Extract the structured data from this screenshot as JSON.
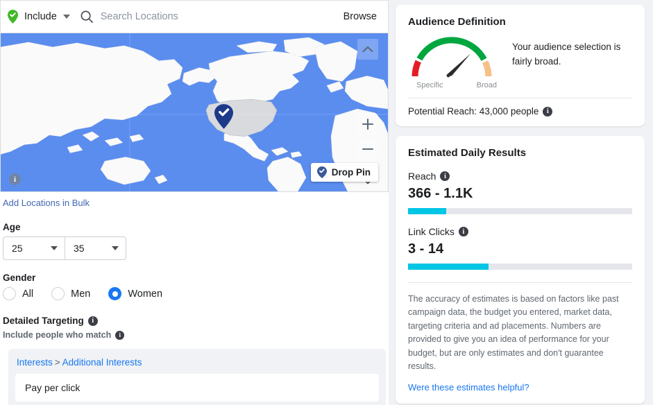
{
  "locations": {
    "include_label": "Include",
    "include_pin_icon": "map-pin-check-green-icon",
    "dropdown_caret_icon": "chevron-down-icon",
    "search_icon": "search-icon",
    "search_placeholder": "Search Locations",
    "search_value": "",
    "browse_label": "Browse",
    "bulk_link": "Add Locations in Bulk"
  },
  "map": {
    "collapse_icon": "chevron-up-icon",
    "zoom_in_icon": "plus-icon",
    "zoom_out_icon": "minus-icon",
    "locate_icon": "map-pin-locate-icon",
    "drop_pin_label": "Drop Pin",
    "drop_pin_icon": "map-pin-check-blue-icon",
    "info_icon": "info-icon",
    "marker_icon": "map-pin-check-navy-icon",
    "ocean_color": "#5b8def",
    "land_color": "#fafafa",
    "selected_region_color": "#d8dade"
  },
  "age": {
    "title": "Age",
    "min": "25",
    "max": "35"
  },
  "gender": {
    "title": "Gender",
    "options": [
      {
        "label": "All",
        "selected": false
      },
      {
        "label": "Men",
        "selected": false
      },
      {
        "label": "Women",
        "selected": true
      }
    ],
    "selected_color": "#1877f2"
  },
  "detailed_targeting": {
    "title": "Detailed Targeting",
    "title_info_icon": "info-icon",
    "subtitle": "Include people who match",
    "subtitle_info_icon": "info-icon",
    "breadcrumb_root": "Interests",
    "breadcrumb_sep": ">",
    "breadcrumb_leaf": "Additional Interests",
    "interest_value": "Pay per click"
  },
  "audience_definition": {
    "title": "Audience Definition",
    "gauge_low_label": "Specific",
    "gauge_high_label": "Broad",
    "gauge_needle_percent": 62,
    "gauge_colors": {
      "low": "#e41e26",
      "mid": "#00a63f",
      "high": "#f5c187"
    },
    "message": "Your audience selection is fairly broad.",
    "reach_label": "Potential Reach: 43,000 people",
    "reach_info_icon": "info-icon"
  },
  "estimated_results": {
    "title": "Estimated Daily Results",
    "metrics": [
      {
        "label": "Reach",
        "info_icon": "info-icon",
        "value": "366 - 1.1K",
        "bar_percent": 17
      },
      {
        "label": "Link Clicks",
        "info_icon": "info-icon",
        "value": "3 - 14",
        "bar_percent": 36
      }
    ],
    "bar_color": "#00c6e5",
    "disclaimer": "The accuracy of estimates is based on factors like past campaign data, the budget you entered, market data, targeting criteria and ad placements. Numbers are provided to give you an idea of performance for your budget, but are only estimates and don't guarantee results.",
    "helpful_link": "Were these estimates helpful?"
  }
}
